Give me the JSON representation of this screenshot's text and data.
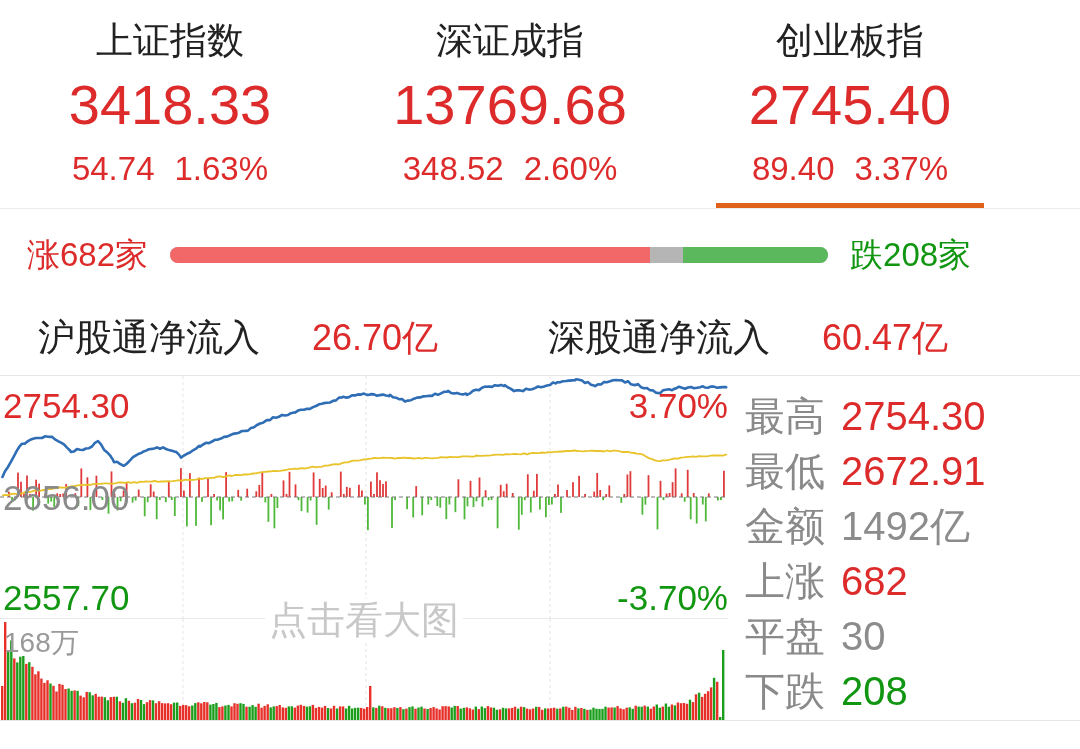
{
  "indices": [
    {
      "name": "上证指数",
      "value": "3418.33",
      "change": "54.74",
      "change_percent": "1.63%",
      "selected": false
    },
    {
      "name": "深证成指",
      "value": "13769.68",
      "change": "348.52",
      "change_percent": "2.60%",
      "selected": false
    },
    {
      "name": "创业板指",
      "value": "2745.40",
      "change": "89.40",
      "change_percent": "3.37%",
      "selected": true
    }
  ],
  "breadth": {
    "advance_label": "涨682家",
    "decline_label": "跌208家",
    "advance_bar": {
      "level": 0.73
    },
    "decline_bar": {
      "level": 0.22
    }
  },
  "northbound_flows": [
    {
      "label": "沪股通净流入",
      "value": "26.70亿"
    },
    {
      "label": "深股通净流入",
      "value": "60.47亿"
    }
  ],
  "intraday_chart": {
    "axis_labels": [
      "2754.30",
      "2656.00",
      "2557.70"
    ],
    "percent_labels": [
      "3.70%",
      "-3.70%"
    ],
    "hint": "点击看大图",
    "volume_label": "168万"
  },
  "stats": [
    {
      "label": "最高",
      "value": "2754.30",
      "kind": "up"
    },
    {
      "label": "最低",
      "value": "2672.91",
      "kind": "up"
    },
    {
      "label": "金额",
      "value": "1492亿",
      "kind": "flat"
    },
    {
      "label": "上涨",
      "value": "682",
      "kind": "up"
    },
    {
      "label": "平盘",
      "value": "30",
      "kind": "flat"
    },
    {
      "label": "下跌",
      "value": "208",
      "kind": "down"
    }
  ]
}
